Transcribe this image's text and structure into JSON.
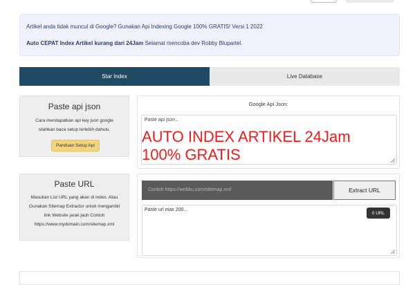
{
  "notice": {
    "line1": "Artikel anda tidak muncul di Google? Gunakan Api Indexing Google 100% GRATIS! Versi 1 2022",
    "line2_bold": "Auto CEPAT Index Artikel kurang dari 24Jam",
    "line2_rest": " Selamat mencoba dev Robby Blupartel."
  },
  "tabs": [
    {
      "label": "Star Index",
      "active": true
    },
    {
      "label": "Live Database",
      "active": false
    }
  ],
  "api_card": {
    "title": "Paste api json",
    "description": "Cara mendapatkan api key json google silahkan baca setup terlebih dahulu.",
    "button": "Panduan Setup Api"
  },
  "url_card": {
    "title": "Paste URL",
    "description": "Masukan List URL yang akan di index. Atau Gunakan Sitemap Extractor untuk mengambil link Website jarak jauh Contoh https://www.mydomain.com/sitemap.xml"
  },
  "api_panel": {
    "label": "Google Api Json:",
    "placeholder": "Paste api json...",
    "overlay_line1": "AUTO INDEX ARTIKEL 24Jam",
    "overlay_line2": "100% GRATIS"
  },
  "url_panel": {
    "sitemap_placeholder": "Contoh https://webku.com/sitemap.xml",
    "extract_button": "Extract URL",
    "urls_placeholder": "Paste url max 200...",
    "url_count": "0 URL"
  },
  "colors": {
    "tab_active": "#1f4a63",
    "guide_button": "#f0d580",
    "overlay_text": "#ee1c1c"
  }
}
